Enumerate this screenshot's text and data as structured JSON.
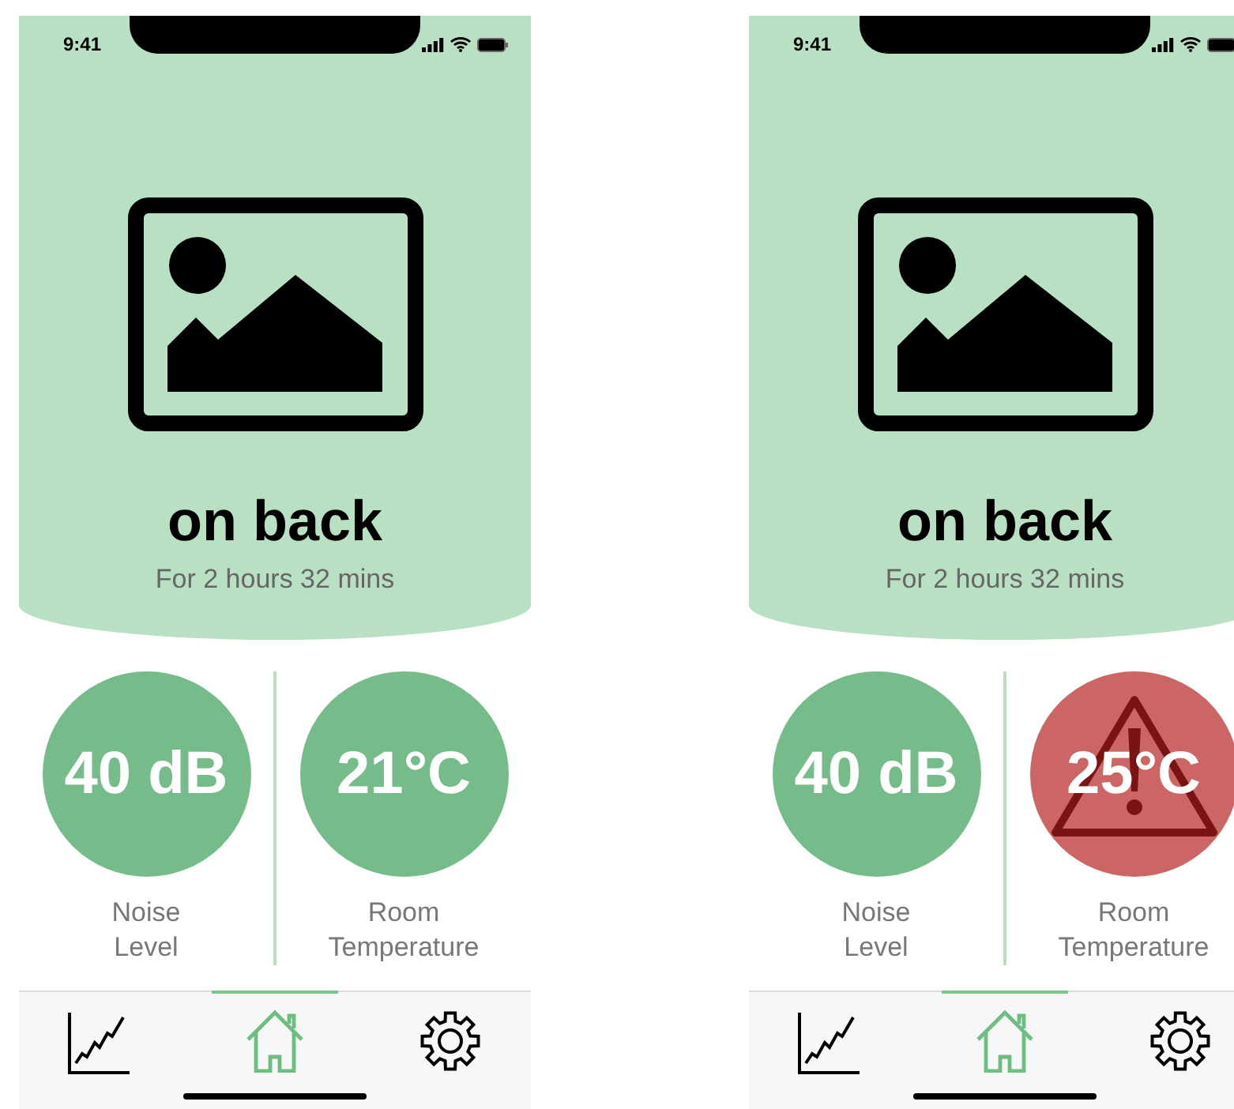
{
  "phones": [
    {
      "status_time": "9:41",
      "title": "on back",
      "subtitle": "For 2 hours 32 mins",
      "metrics": [
        {
          "value": "40 dB",
          "label": "Noise Level",
          "warning": false
        },
        {
          "value": "21°C",
          "label": "Room Temperature",
          "warning": false
        }
      ],
      "tabs": [
        {
          "kind": "chart",
          "selected": false
        },
        {
          "kind": "home",
          "selected": true
        },
        {
          "kind": "settings",
          "selected": false
        }
      ]
    },
    {
      "status_time": "9:41",
      "title": "on back",
      "subtitle": "For 2 hours 32 mins",
      "metrics": [
        {
          "value": "40 dB",
          "label": "Noise Level",
          "warning": false
        },
        {
          "value": "25°C",
          "label": "Room Temperature",
          "warning": true
        }
      ],
      "tabs": [
        {
          "kind": "chart",
          "selected": false
        },
        {
          "kind": "home",
          "selected": true
        },
        {
          "kind": "settings",
          "selected": false
        }
      ]
    }
  ]
}
